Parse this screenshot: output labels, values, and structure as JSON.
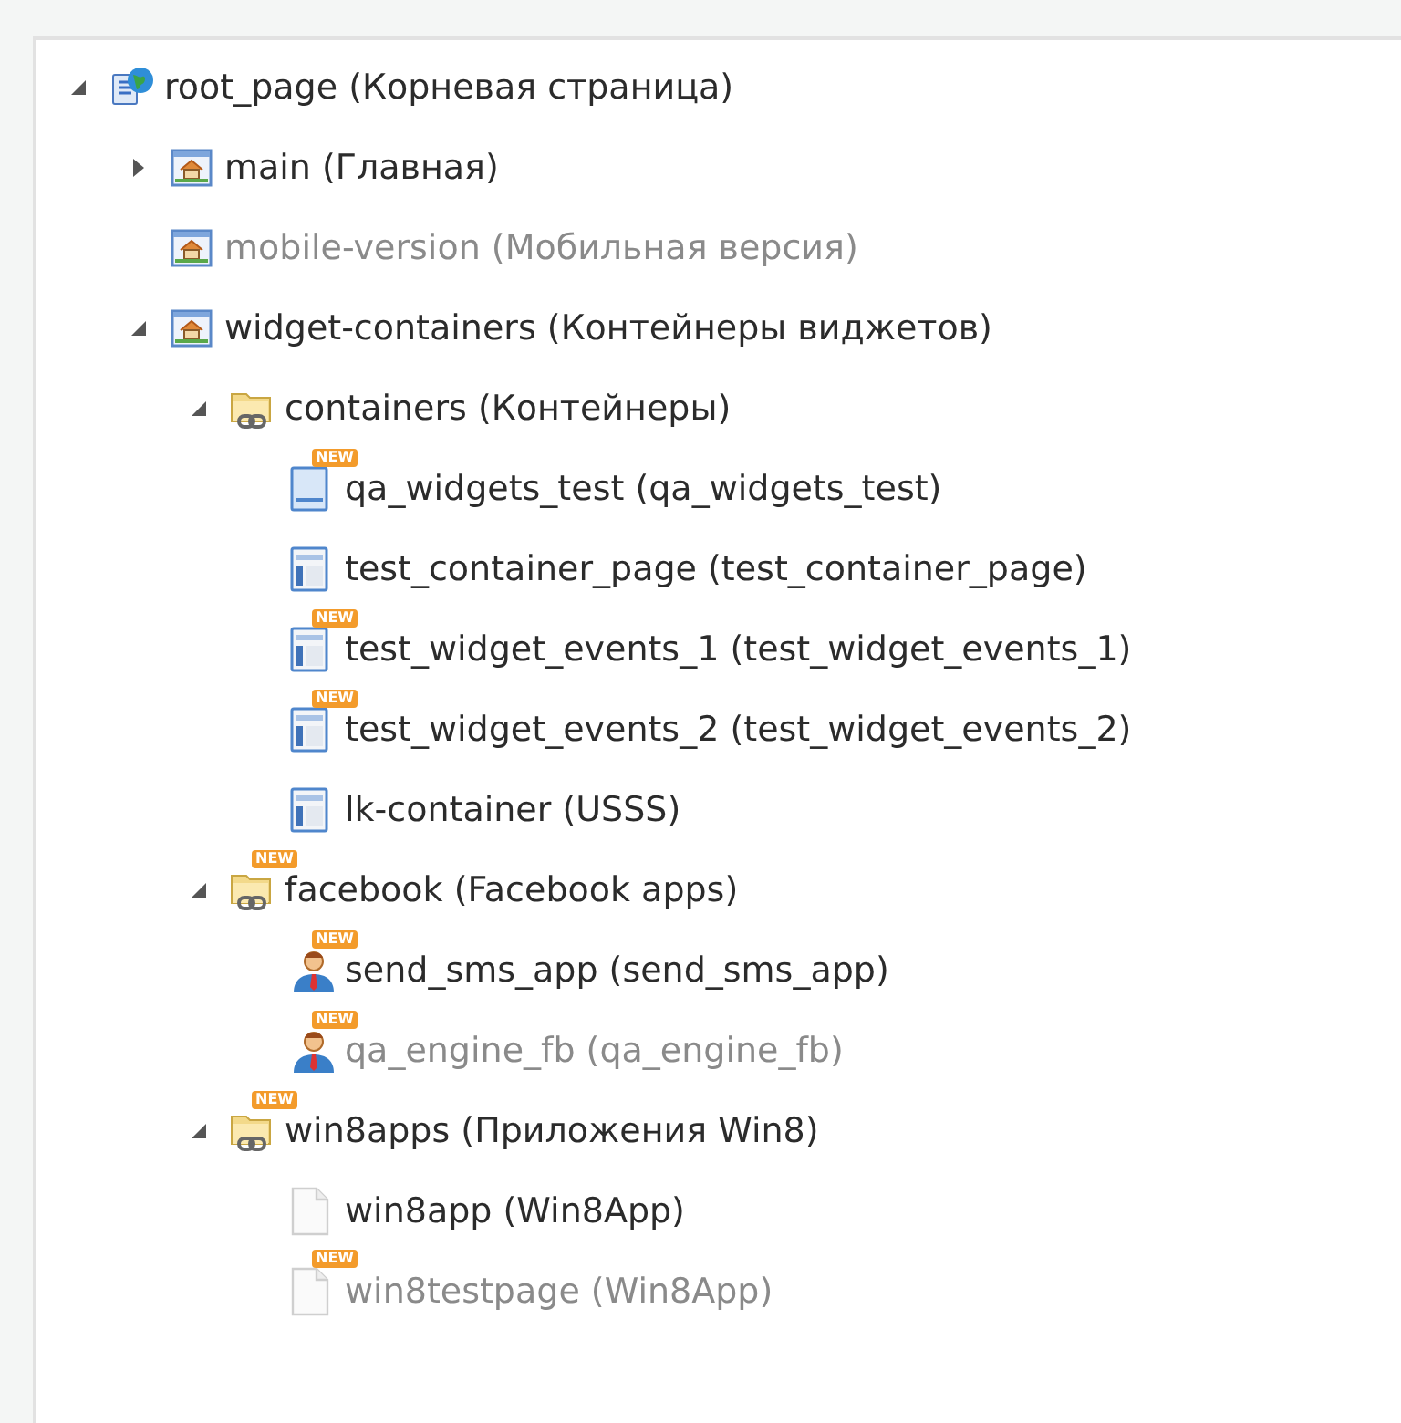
{
  "tree": [
    {
      "kind": "globe-page",
      "name": "root_page",
      "title": "(Корневая страница)",
      "disabled": false,
      "expanded": true,
      "children": [
        {
          "kind": "home-page",
          "name": "main",
          "title": "(Главная)",
          "disabled": false,
          "expanded": false
        },
        {
          "kind": "home-page",
          "name": "mobile-version",
          "title": "(Мобильная версия)",
          "disabled": true
        },
        {
          "kind": "home-page",
          "name": "widget-containers",
          "title": "(Контейнеры виджетов)",
          "disabled": false,
          "expanded": true,
          "children": [
            {
              "kind": "folder-link",
              "name": "containers",
              "title": "(Контейнеры)",
              "disabled": false,
              "expanded": true,
              "children": [
                {
                  "kind": "form-page",
                  "name": "qa_widgets_test",
                  "title": "(qa_widgets_test)",
                  "disabled": false,
                  "badge": "NEW"
                },
                {
                  "kind": "layout-page",
                  "name": "test_container_page",
                  "title": "(test_container_page)",
                  "disabled": false
                },
                {
                  "kind": "layout-page",
                  "name": "test_widget_events_1",
                  "title": "(test_widget_events_1)",
                  "disabled": false,
                  "badge": "NEW"
                },
                {
                  "kind": "layout-page",
                  "name": "test_widget_events_2",
                  "title": "(test_widget_events_2)",
                  "disabled": false,
                  "badge": "NEW"
                },
                {
                  "kind": "layout-page",
                  "name": "lk-container",
                  "title": "(USSS)",
                  "disabled": false
                }
              ]
            },
            {
              "kind": "folder-link",
              "name": "facebook",
              "title": "(Facebook apps)",
              "disabled": false,
              "expanded": true,
              "badge": "NEW",
              "children": [
                {
                  "kind": "user",
                  "name": "send_sms_app",
                  "title": "(send_sms_app)",
                  "disabled": false,
                  "badge": "NEW"
                },
                {
                  "kind": "user",
                  "name": "qa_engine_fb",
                  "title": "(qa_engine_fb)",
                  "disabled": true,
                  "badge": "NEW"
                }
              ]
            },
            {
              "kind": "folder-link",
              "name": "win8apps",
              "title": "(Приложения Win8)",
              "disabled": false,
              "expanded": true,
              "badge": "NEW",
              "children": [
                {
                  "kind": "blank-page",
                  "name": "win8app",
                  "title": "(Win8App)",
                  "disabled": false
                },
                {
                  "kind": "blank-page",
                  "name": "win8testpage",
                  "title": "(Win8App)",
                  "disabled": true,
                  "badge": "NEW"
                }
              ]
            }
          ]
        }
      ]
    }
  ]
}
